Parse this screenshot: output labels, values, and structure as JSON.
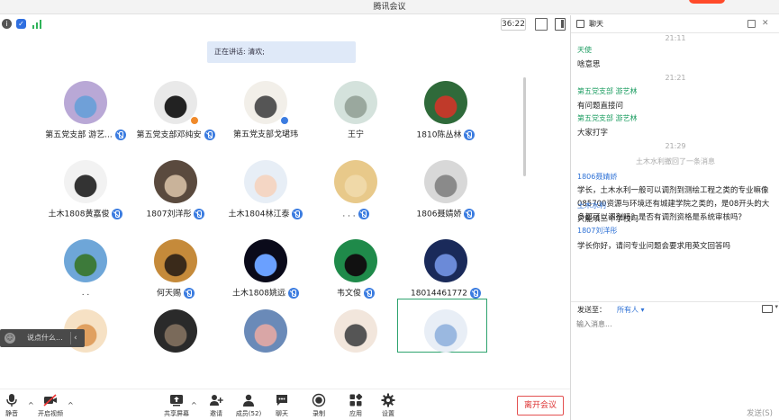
{
  "window": {
    "title": "腾讯会议"
  },
  "status": {
    "timer": "36:22"
  },
  "speaking": {
    "text": "正在讲话: 清欢;"
  },
  "participants": [
    {
      "name": "第五党支部 游艺...",
      "muted": true,
      "color": "#b9a8d6",
      "inner": "#6fa0d8"
    },
    {
      "name": "第五党支部邓纯安",
      "muted": true,
      "color": "#e9e9e9",
      "inner": "#222222"
    },
    {
      "name": "第五党支部戈珺玮",
      "muted": false,
      "color": "#f2efe9",
      "inner": "#555555"
    },
    {
      "name": "王宁",
      "muted": false,
      "color": "#d4e2dc",
      "inner": "#9aa89e"
    },
    {
      "name": "1810陈丛林",
      "muted": true,
      "color": "#2f6a3a",
      "inner": "#c03a2a"
    },
    {
      "name": "土木1808黄嘉俊",
      "muted": true,
      "color": "#f2f2f2",
      "inner": "#333333"
    },
    {
      "name": "1807刘洋彤",
      "muted": true,
      "color": "#5a4a3e",
      "inner": "#c9b39a"
    },
    {
      "name": "土木1804林江泰",
      "muted": true,
      "color": "#e7eef6",
      "inner": "#f4d6c4"
    },
    {
      "name": ". . .",
      "muted": true,
      "color": "#e8c98a",
      "inner": "#f0d9a8"
    },
    {
      "name": "1806聂婧娇",
      "muted": true,
      "color": "#d8d8d8",
      "inner": "#8a8a8a"
    },
    {
      "name": ". .",
      "muted": false,
      "color": "#6ea6d8",
      "inner": "#3d7a3a"
    },
    {
      "name": "何天赐",
      "muted": true,
      "color": "#c58a3a",
      "inner": "#3a2a1a"
    },
    {
      "name": "土木1808姚远",
      "muted": true,
      "color": "#0a0a1a",
      "inner": "#6aa0ff"
    },
    {
      "name": "韦文俊",
      "muted": true,
      "color": "#1f8a4a",
      "inner": "#111111"
    },
    {
      "name": "18014461772",
      "muted": true,
      "color": "#1a2a5a",
      "inner": "#6b8ad8"
    },
    {
      "name": "",
      "muted": false,
      "color": "#f6e1c4",
      "inner": "#e0a060"
    },
    {
      "name": "",
      "muted": false,
      "color": "#2a2a2a",
      "inner": "#7a6a5a"
    },
    {
      "name": "",
      "muted": false,
      "color": "#6a8ab8",
      "inner": "#d9a6a6"
    },
    {
      "name": "",
      "muted": false,
      "color": "#f2e6dc",
      "inner": "#555555"
    },
    {
      "name": "",
      "muted": false,
      "color": "#e8eef6",
      "inner": "#9ab8e0"
    }
  ],
  "say_box": {
    "placeholder": "说点什么..."
  },
  "toolbar": {
    "mute": "静音",
    "video": "开启视频",
    "share": "共享屏幕",
    "invite": "邀请",
    "members": "成员(52)",
    "chat": "聊天",
    "record": "录制",
    "apps": "应用",
    "settings": "设置",
    "leave": "离开会议"
  },
  "chat": {
    "title": "聊天",
    "messages": [
      {
        "kind": "time",
        "text": "21:11"
      },
      {
        "kind": "sender",
        "text": "天使",
        "color": "green"
      },
      {
        "kind": "text",
        "text": "啥意思"
      },
      {
        "kind": "time",
        "text": "21:21"
      },
      {
        "kind": "sender",
        "text": "第五党支部 游艺林",
        "color": "green"
      },
      {
        "kind": "text",
        "text": "有问题直接问"
      },
      {
        "kind": "sender",
        "text": "第五党支部 游艺林",
        "color": "green"
      },
      {
        "kind": "text",
        "text": "大家打字"
      },
      {
        "kind": "time",
        "text": "21:29"
      },
      {
        "kind": "system",
        "text": "土木水利撤回了一条消息"
      },
      {
        "kind": "sender",
        "text": "1806聂婧娇",
        "color": "blue"
      },
      {
        "kind": "text",
        "text": "学长，土木水利一般可以调剂到测绘工程之类的专业嘛像085700资源与环境还有城建学院之类的，是08开头的大多都可以调剂吗？是否有调剂资格是系统审核吗？"
      },
      {
        "kind": "sender",
        "text": "土木水利",
        "color": "blue"
      },
      {
        "kind": "text",
        "text": "只能填三个学校吗"
      },
      {
        "kind": "sender",
        "text": "1807刘洋彤",
        "color": "blue"
      },
      {
        "kind": "text",
        "text": "学长你好，请问专业问题会要求用英文回答吗"
      }
    ],
    "send_to_label": "发送至：",
    "send_to_value": "所有人",
    "input_placeholder": "输入消息...",
    "send": "发送(S)"
  }
}
